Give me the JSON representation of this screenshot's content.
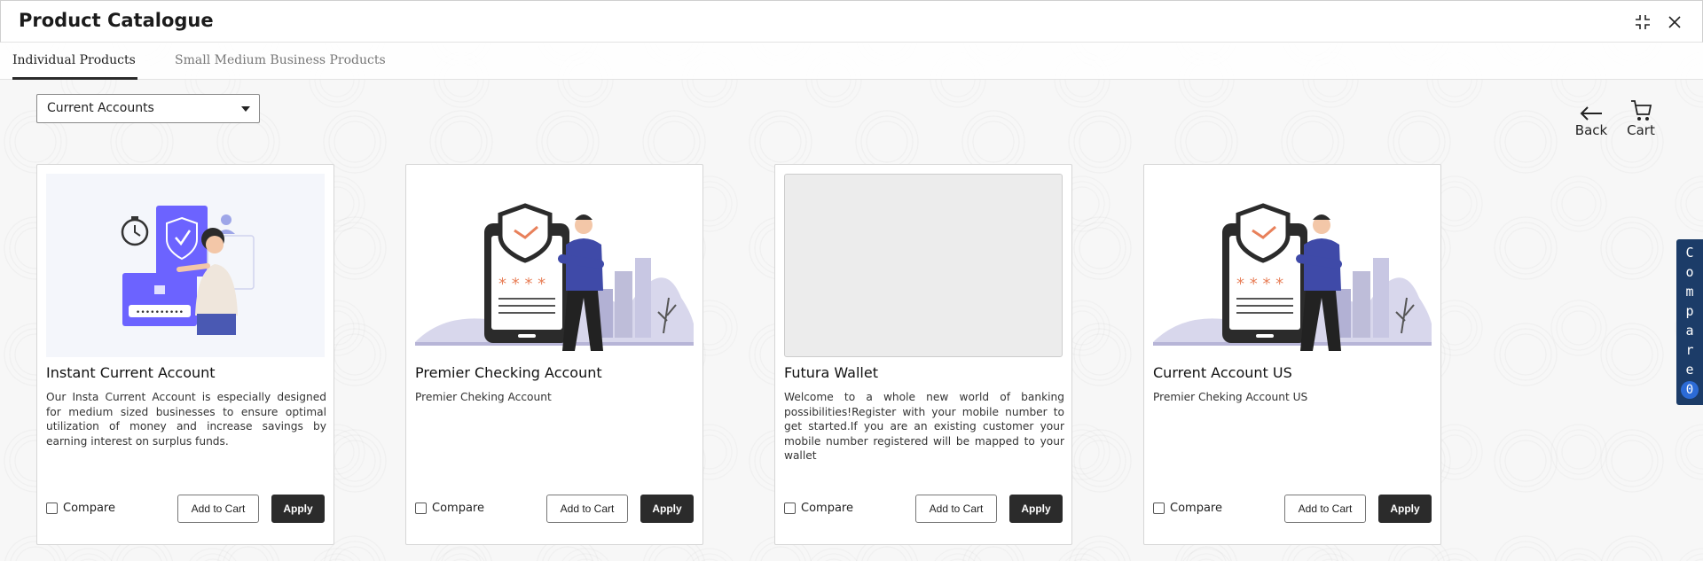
{
  "header": {
    "title": "Product Catalogue",
    "icons": [
      "collapse-icon",
      "close-icon"
    ]
  },
  "tabs": [
    {
      "label": "Individual Products",
      "active": true
    },
    {
      "label": "Small Medium Business Products",
      "active": false
    }
  ],
  "filter": {
    "selected": "Current Accounts"
  },
  "nav": {
    "back_label": "Back",
    "cart_label": "Cart"
  },
  "cards": [
    {
      "title": "Instant Current Account",
      "description": "Our Insta Current Account is especially designed for medium sized businesses to ensure optimal utilization of money and increase savings by earning interest on surplus funds.",
      "image": "security-illustration",
      "compare_label": "Compare",
      "add_to_cart_label": "Add to Cart",
      "apply_label": "Apply"
    },
    {
      "title": "Premier Checking Account",
      "description": "Premier Cheking Account",
      "image": "shield-phone-illustration",
      "compare_label": "Compare",
      "add_to_cart_label": "Add to Cart",
      "apply_label": "Apply"
    },
    {
      "title": "Futura Wallet",
      "description": "Welcome to a whole new world of banking possibilities!Register with your mobile number to get started.If you are an existing customer your mobile number registered will be mapped to your wallet",
      "image": "placeholder",
      "compare_label": "Compare",
      "add_to_cart_label": "Add to Cart",
      "apply_label": "Apply"
    },
    {
      "title": "Current Account US",
      "description": "Premier Cheking Account US",
      "image": "shield-phone-illustration",
      "compare_label": "Compare",
      "add_to_cart_label": "Add to Cart",
      "apply_label": "Apply"
    }
  ],
  "compare_tab": {
    "letters": [
      "C",
      "o",
      "m",
      "p",
      "a",
      "r",
      "e"
    ],
    "count": "0"
  },
  "colors": {
    "accent_dark": "#2b2b2b",
    "compare_bg": "#1c3c68",
    "illustration_purple": "#5b5fd6"
  }
}
